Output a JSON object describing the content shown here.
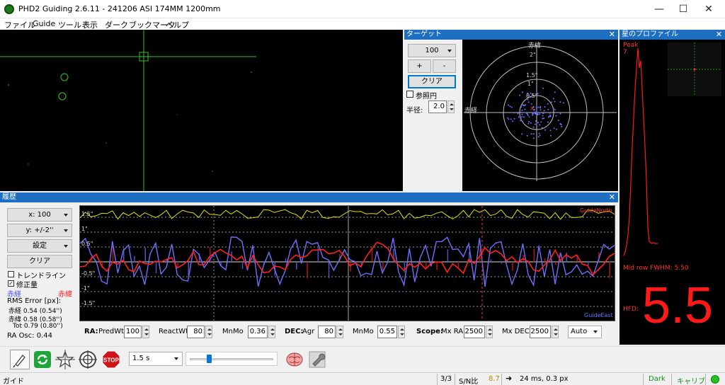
{
  "window": {
    "title": "PHD2 Guiding 2.6.11 - 241206 ASI 174MM  1200mm",
    "controls": [
      "—",
      "☐",
      "✕"
    ]
  },
  "menu": [
    "ファイル",
    "Guide",
    "ツール",
    "表示",
    "ダーク",
    "ブックマーク",
    "ヘルプ"
  ],
  "target": {
    "title": "ターゲット",
    "length": "100",
    "zoom_in": "+",
    "zoom_out": "-",
    "clear": "クリア",
    "ref_circle": "参照円",
    "radius_label": "半径:",
    "radius": "2.0",
    "axis_dec": "赤緯",
    "axis_ra": "赤経",
    "ring_labels": [
      "2\"",
      "1.5\"",
      "1\"",
      "0.5\""
    ]
  },
  "profile": {
    "title": "星のプロファイル",
    "peak_label": "Peak",
    "peak_value": "7",
    "fwhm": "Mid row FWHM: 5.50",
    "hfd_label": "HFD:",
    "hfd_value": "5.5"
  },
  "history": {
    "title": "履歴",
    "x_scale": "x: 100",
    "y_scale": "y: +/-2''",
    "settings": "設定",
    "clear": "クリア",
    "trendline": "トレンドライン",
    "correction": "修正量",
    "ra_legend": "赤経",
    "dec_legend": "赤緯",
    "rms_title": "RMS Error [px]:",
    "rms_ra": "赤経  0.54 (0.54'')",
    "rms_dec": "赤緯  0.58 (0.58'')",
    "rms_tot": "Tot  0.79 (0.80'')",
    "ra_osc": "RA Osc: 0.44",
    "y_labels": [
      "1.5\"",
      "1\"",
      "0.5\"",
      "-0.5\"",
      "-1\"",
      "-1.5\""
    ],
    "label_top_right": "GuideNorth",
    "label_bottom_right": "GuideEast"
  },
  "params": {
    "ra_label": "RA:",
    "predwt_label": "PredWt",
    "predwt": "100",
    "reactwt_label": "ReactWt",
    "reactwt": "80",
    "mnmo_label": "MnMo",
    "ra_mnmo": "0.36",
    "dec_label": "DEC:",
    "agr_label": "Agr",
    "dec_agr": "80",
    "dec_mnmo_label": "MnMo",
    "dec_mnmo": "0.55",
    "scope_label": "Scope:",
    "mxra_label": "Mx RA",
    "mxra": "2500",
    "mxdec_label": "Mx DEC",
    "mxdec": "2500",
    "dec_mode": "Auto"
  },
  "toolbar": {
    "exposure": "1.5 s"
  },
  "status": {
    "left": "ガイド",
    "frames": "3/3",
    "sn_label": "S/N比",
    "sn_value": "8.7",
    "info": "24 ms, 0.3 px",
    "theme": "Dark",
    "calib": "キャリブ"
  },
  "colors": {
    "ra": "#6f6fff",
    "dec": "#ff2020",
    "snr_line": "#e0e000",
    "reticle": "#27c827",
    "hfd": "#ff1a1a",
    "panel_head": "#1e6fc2"
  }
}
